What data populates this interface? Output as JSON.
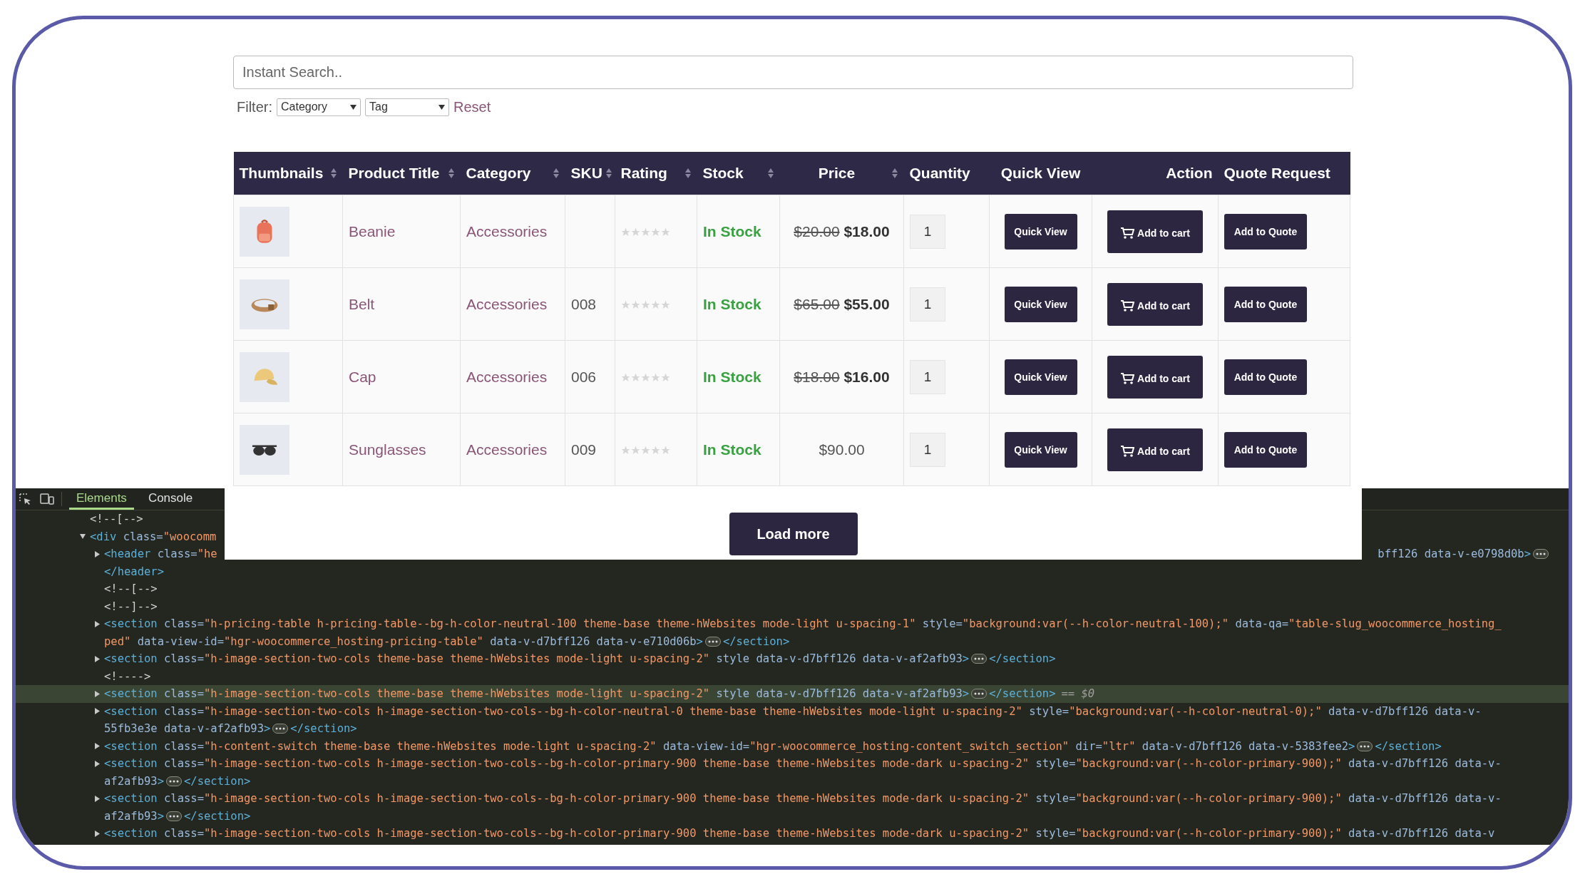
{
  "search": {
    "placeholder": "Instant Search.."
  },
  "filter": {
    "label": "Filter:",
    "selects": [
      "Category",
      "Tag"
    ],
    "reset": "Reset"
  },
  "table": {
    "columns": [
      {
        "label": "Thumbnails",
        "sortable": true
      },
      {
        "label": "Product Title",
        "sortable": true
      },
      {
        "label": "Category",
        "sortable": true
      },
      {
        "label": "SKU",
        "sortable": true
      },
      {
        "label": "Rating",
        "sortable": true
      },
      {
        "label": "Stock",
        "sortable": true
      },
      {
        "label": "Price",
        "sortable": true
      },
      {
        "label": "Quantity",
        "sortable": false
      },
      {
        "label": "Quick View",
        "sortable": false
      },
      {
        "label": "Action",
        "sortable": false
      },
      {
        "label": "Quote Request",
        "sortable": false
      }
    ],
    "rows": [
      {
        "kind": "backpack",
        "title": "Beanie",
        "category": "Accessories",
        "stars": 0,
        "stock": "In Stock",
        "old_price": "$20.00",
        "price": "$18.00",
        "quantity": "1",
        "quick_view": "Quick View",
        "add_to_cart": "Add to cart",
        "add_to_quote": "Add to Quote"
      },
      {
        "kind": "belt",
        "title": "Belt",
        "category": "Accessories",
        "sku": "008",
        "stars": 0,
        "stock": "In Stock",
        "old_price": "$65.00",
        "price": "$55.00",
        "quantity": "1",
        "quick_view": "Quick View",
        "add_to_cart": "Add to cart",
        "add_to_quote": "Add to Quote"
      },
      {
        "kind": "cap",
        "title": "Cap",
        "category": "Accessories",
        "sku": "006",
        "stars": 0,
        "stock": "In Stock",
        "old_price": "$18.00",
        "price": "$16.00",
        "quantity": "1",
        "quick_view": "Quick View",
        "add_to_cart": "Add to cart",
        "add_to_quote": "Add to Quote"
      },
      {
        "kind": "sunglasses",
        "title": "Sunglasses",
        "category": "Accessories",
        "sku": "009",
        "stars": 0,
        "stock": "In Stock",
        "price": "$90.00",
        "quantity": "1",
        "quick_view": "Quick View",
        "add_to_cart": "Add to cart",
        "add_to_quote": "Add to Quote"
      }
    ]
  },
  "load_more": "Load more",
  "devtools": {
    "tabs": [
      {
        "label": "Elements",
        "selected": true
      },
      {
        "label": "Console",
        "selected": false
      }
    ],
    "tree": [
      {
        "lines": [
          "<!--[-->"
        ],
        "selected": false
      },
      {
        "lines": [
          "<div class=\"woocomm"
        ],
        "expanded": true,
        "selected": false,
        "children": [
          {
            "lines": [
              "<header class=\"he"
            ],
            "tail": "bff126 data-v-e0798d0b>",
            "ellipsis": true,
            "end_line": "</header>",
            "expanded": false,
            "selected": false
          },
          {
            "lines": [
              "<!--[-->"
            ],
            "selected": false
          },
          {
            "lines": [
              "<!--]-->"
            ],
            "selected": false
          },
          {
            "lines": [
              "<section class=\"h-pricing-table h-pricing-table--bg-h-color-neutral-100 theme-base theme-hWebsites mode-light u-spacing-1\" style=\"background:var(--h-color-neutral-100);\" data-qa=\"table-slug_woocommerce_hosting_",
              "ped\" data-view-id=\"hgr-woocommerce_hosting-pricing-table\" data-v-d7bff126 data-v-e710d06b>"
            ],
            "ellipsis": true,
            "close": "</section>",
            "expanded": false,
            "selected": false
          },
          {
            "lines": [
              "<section class=\"h-image-section-two-cols theme-base theme-hWebsites mode-light u-spacing-2\" style data-v-d7bff126 data-v-af2afb93>"
            ],
            "ellipsis": true,
            "close": "</section>",
            "expanded": false,
            "selected": false
          },
          {
            "lines": [
              "<!---->"
            ],
            "selected": false
          },
          {
            "lines": [
              "<section class=\"h-image-section-two-cols theme-base theme-hWebsites mode-light u-spacing-2\" style data-v-d7bff126 data-v-af2afb93>"
            ],
            "ellipsis": true,
            "close": "</section>",
            "note": "== $0",
            "expanded": false,
            "selected": true
          },
          {
            "lines": [
              "<section class=\"h-image-section-two-cols h-image-section-two-cols--bg-h-color-neutral-0 theme-base theme-hWebsites mode-light u-spacing-2\" style=\"background:var(--h-color-neutral-0);\" data-v-d7bff126 data-v-",
              "55fb3e3e data-v-af2afb93>"
            ],
            "ellipsis": true,
            "close": "</section>",
            "expanded": false,
            "selected": false
          },
          {
            "lines": [
              "<section class=\"h-content-switch theme-base theme-hWebsites mode-light u-spacing-2\" data-view-id=\"hgr-woocommerce_hosting-content_switch_section\" dir=\"ltr\" data-v-d7bff126 data-v-5383fee2>"
            ],
            "ellipsis": true,
            "close": "</section>",
            "expanded": false,
            "selected": false
          },
          {
            "lines": [
              "<section class=\"h-image-section-two-cols h-image-section-two-cols--bg-h-color-primary-900 theme-base theme-hWebsites mode-dark u-spacing-2\" style=\"background:var(--h-color-primary-900);\" data-v-d7bff126 data-v-",
              "af2afb93>"
            ],
            "ellipsis": true,
            "close": "</section>",
            "expanded": false,
            "selected": false
          },
          {
            "lines": [
              "<section class=\"h-image-section-two-cols h-image-section-two-cols--bg-h-color-primary-900 theme-base theme-hWebsites mode-dark u-spacing-2\" style=\"background:var(--h-color-primary-900);\" data-v-d7bff126 data-v-",
              "af2afb93>"
            ],
            "ellipsis": true,
            "close": "</section>",
            "expanded": false,
            "selected": false
          },
          {
            "lines": [
              "<section class=\"h-image-section-two-cols h-image-section-two-cols--bg-h-color-primary-900 theme-base theme-hWebsites mode-dark u-spacing-2\" style=\"background:var(--h-color-primary-900);\" data-v-d7bff126 data-v"
            ],
            "expanded": false,
            "selected": false
          }
        ]
      }
    ]
  }
}
